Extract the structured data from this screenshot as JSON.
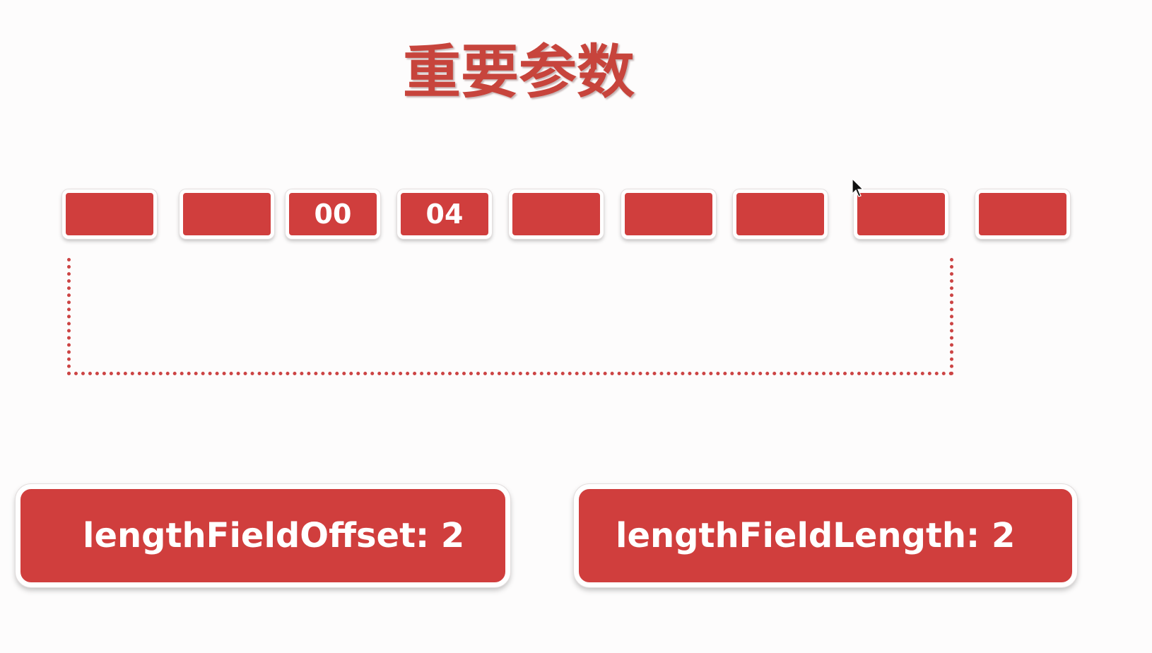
{
  "title": "重要参数",
  "bytes": [
    "",
    "",
    "00",
    "04",
    "",
    "",
    "",
    "",
    ""
  ],
  "params": {
    "offset_label": "lengthFieldOffset: 2",
    "length_label": "lengthFieldLength: 2"
  },
  "colors": {
    "accent": "#d03e3d",
    "title": "#c7443c",
    "dotted_line": "#cc4444",
    "background": "#fdfcfc"
  }
}
